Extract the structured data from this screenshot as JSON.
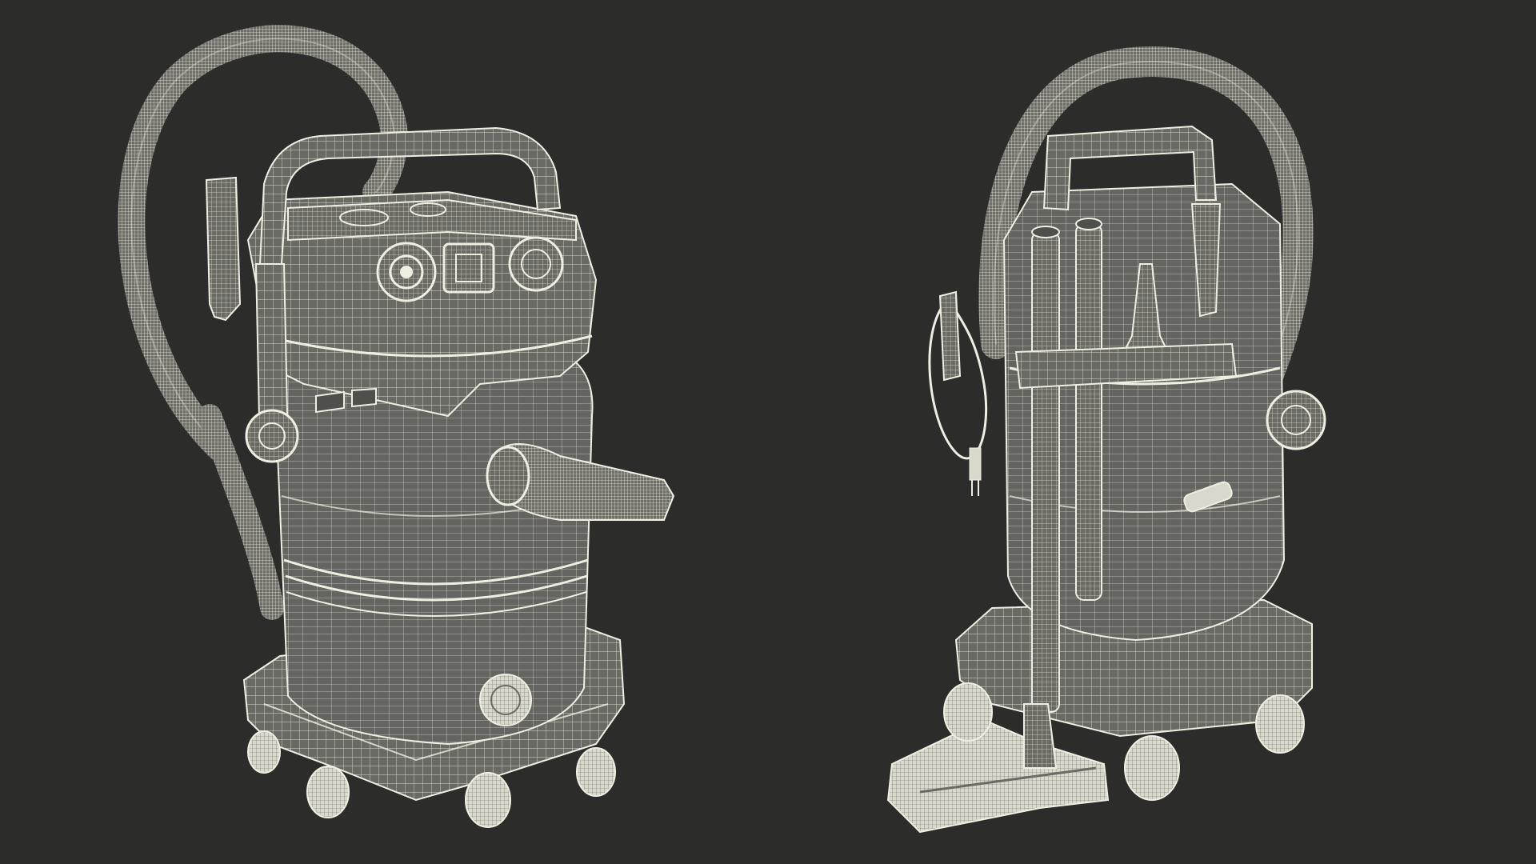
{
  "scene": {
    "background_color": "#2c2c2b",
    "wire_color": "#eeeee2",
    "surface_color": "#6a6a65",
    "surface_dark_color": "#4f4f4b",
    "objects": [
      {
        "name": "vacuum-front-view"
      },
      {
        "name": "vacuum-back-view"
      }
    ]
  }
}
